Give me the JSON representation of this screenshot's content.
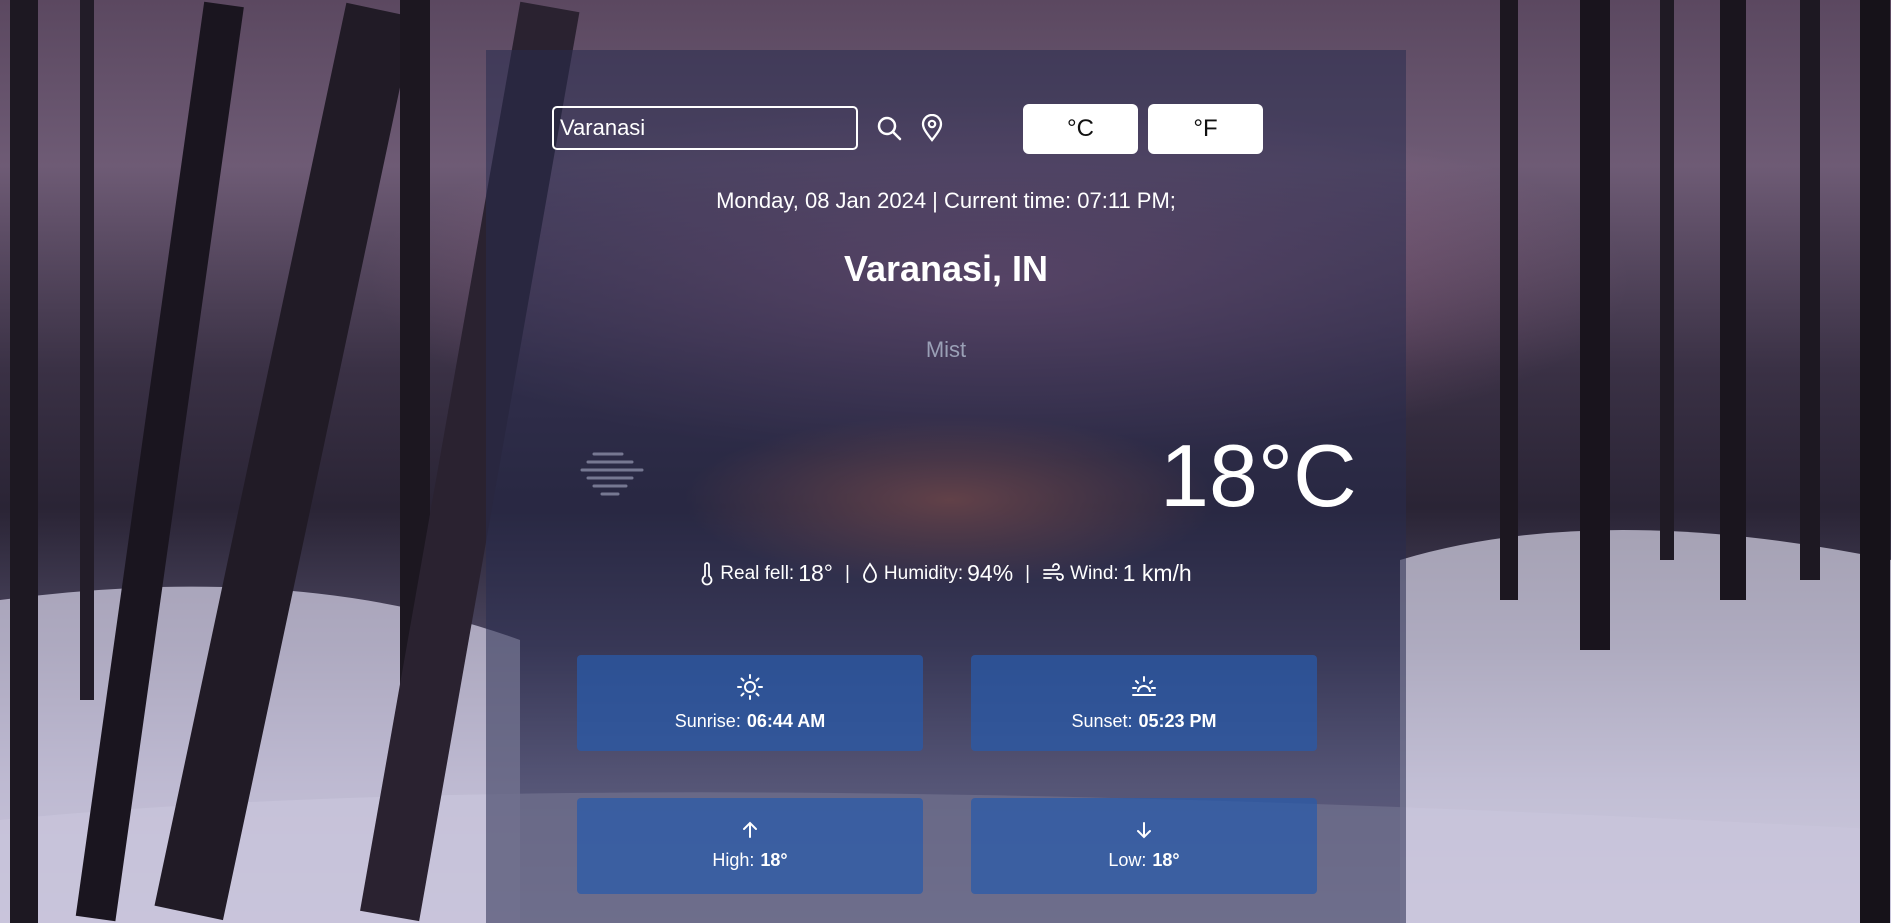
{
  "search": {
    "value": "Varanasi"
  },
  "units": {
    "celsius": "°C",
    "fahrenheit": "°F"
  },
  "datetime": "Monday, 08 Jan 2024 | Current time: 07:11 PM;",
  "city": "Varanasi, IN",
  "condition": "Mist",
  "temperature": "18°C",
  "details": {
    "real_feel_label": "Real fell:",
    "real_feel_value": "18°",
    "humidity_label": "Humidity:",
    "humidity_value": "94%",
    "wind_label": "Wind:",
    "wind_value": "1 km/h",
    "separator": "|"
  },
  "cards": {
    "sunrise": {
      "label": "Sunrise:",
      "value": "06:44 AM"
    },
    "sunset": {
      "label": "Sunset:",
      "value": "05:23 PM"
    },
    "high": {
      "label": "High:",
      "value": "18°"
    },
    "low": {
      "label": "Low:",
      "value": "18°"
    }
  },
  "icons": {
    "search": "search-icon",
    "location": "location-pin-icon",
    "condition": "mist-icon"
  },
  "colors": {
    "panel": "#282c4e",
    "card": "#285aaa",
    "condition_text": "#9aa0b6"
  }
}
